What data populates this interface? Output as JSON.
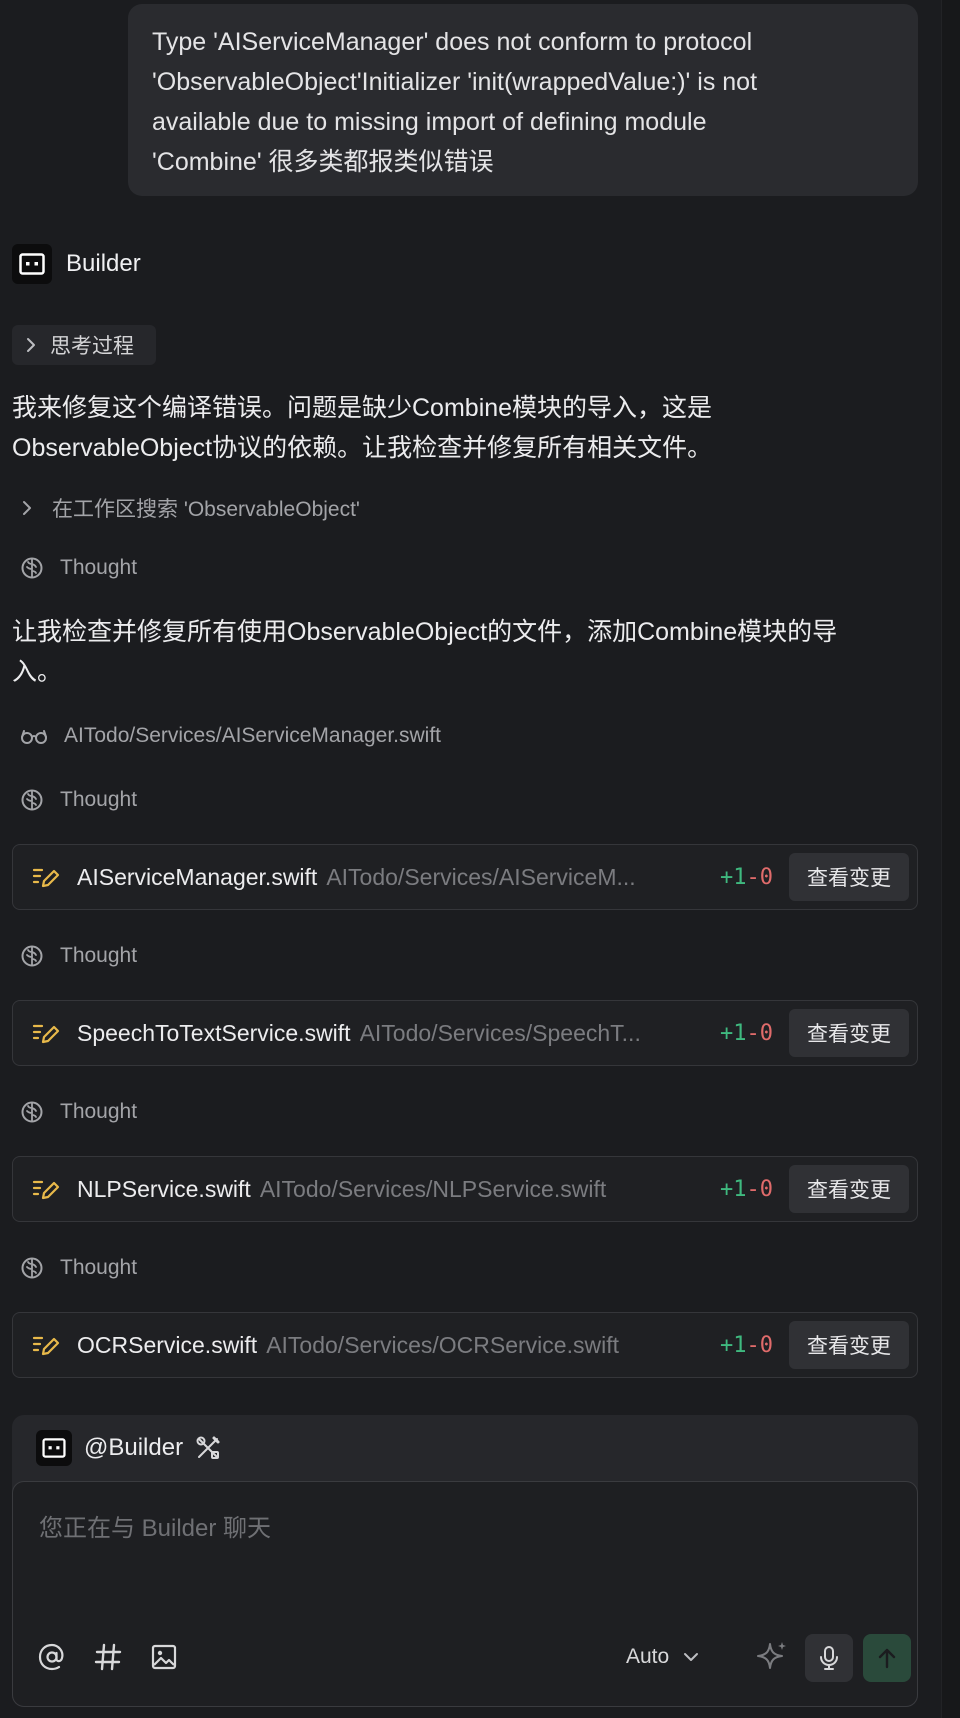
{
  "user_message": {
    "line1": "Type 'AIServiceManager' does not conform to protocol",
    "line2": "'ObservableObject'Initializer 'init(wrappedValue:)' is not",
    "line3": "available due to missing import of defining module",
    "line4": "'Combine' 很多类都报类似错误"
  },
  "agent": {
    "name": "Builder",
    "icon": "builder-avatar-icon",
    "thinking_label": "思考过程",
    "intro_line1": "我来修复这个编译错误。问题是缺少Combine模块的导入，这是",
    "intro_line2": "ObservableObject协议的依赖。让我检查并修复所有相关文件。",
    "search_step": "在工作区搜索 'ObservableObject'",
    "thought_label": "Thought",
    "plan_line1": "让我检查并修复所有使用ObservableObject的文件，添加Combine模块的导",
    "plan_line2": "入。",
    "read_step": "AITodo/Services/AIServiceManager.swift"
  },
  "edits": [
    {
      "file": "AIServiceManager.swift",
      "path": "AITodo/Services/AIServiceM...",
      "added": "+1",
      "removed": "-0",
      "button": "查看变更"
    },
    {
      "file": "SpeechToTextService.swift",
      "path": "AITodo/Services/SpeechT...",
      "added": "+1",
      "removed": "-0",
      "button": "查看变更"
    },
    {
      "file": "NLPService.swift",
      "path": "AITodo/Services/NLPService.swift",
      "added": "+1",
      "removed": "-0",
      "button": "查看变更"
    },
    {
      "file": "OCRService.swift",
      "path": "AITodo/Services/OCRService.swift",
      "added": "+1",
      "removed": "-0",
      "button": "查看变更"
    }
  ],
  "composer": {
    "mention": "@Builder",
    "placeholder": "您正在与 Builder 聊天",
    "model": "Auto"
  },
  "colors": {
    "background": "#1b1c1f",
    "added": "#3fb97f",
    "removed": "#e06b6b",
    "edit_icon": "#e8b94a",
    "send_button": "#2a4a3b"
  }
}
